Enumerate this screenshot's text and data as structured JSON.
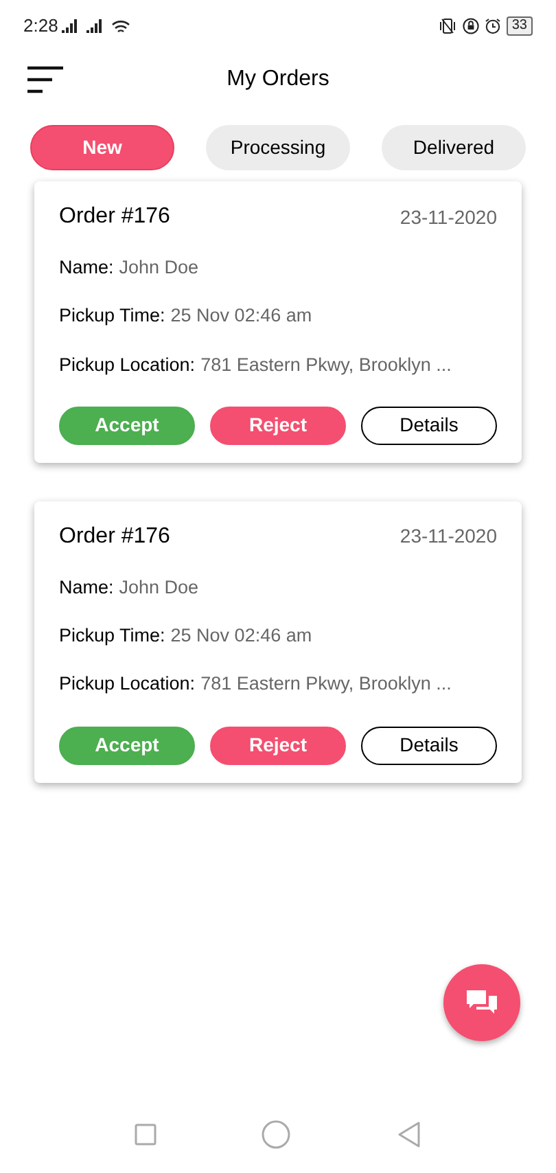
{
  "status_bar": {
    "time": "2:28",
    "battery": "33"
  },
  "header": {
    "title": "My Orders"
  },
  "tabs": [
    {
      "label": "New",
      "selected": true
    },
    {
      "label": "Processing",
      "selected": false
    },
    {
      "label": "Delivered",
      "selected": false
    }
  ],
  "orders": [
    {
      "title": "Order #176",
      "date": "23-11-2020",
      "fields": [
        {
          "label": "Name:",
          "value": "John Doe"
        },
        {
          "label": "Pickup Time:",
          "value": "25 Nov 02:46 am"
        },
        {
          "label": "Pickup Location:",
          "value": "781 Eastern Pkwy, Brooklyn ..."
        }
      ],
      "buttons": [
        {
          "label": "Accept",
          "kind": "accept"
        },
        {
          "label": "Reject",
          "kind": "reject"
        },
        {
          "label": "Details",
          "kind": "details"
        }
      ]
    },
    {
      "title": "Order #176",
      "date": "23-11-2020",
      "fields": [
        {
          "label": "Name:",
          "value": "John Doe"
        },
        {
          "label": "Pickup Time:",
          "value": "25 Nov 02:46 am"
        },
        {
          "label": "Pickup Location:",
          "value": "781 Eastern Pkwy, Brooklyn ..."
        }
      ],
      "buttons": [
        {
          "label": "Accept",
          "kind": "accept"
        },
        {
          "label": "Reject",
          "kind": "reject"
        },
        {
          "label": "Details",
          "kind": "details"
        }
      ]
    }
  ]
}
